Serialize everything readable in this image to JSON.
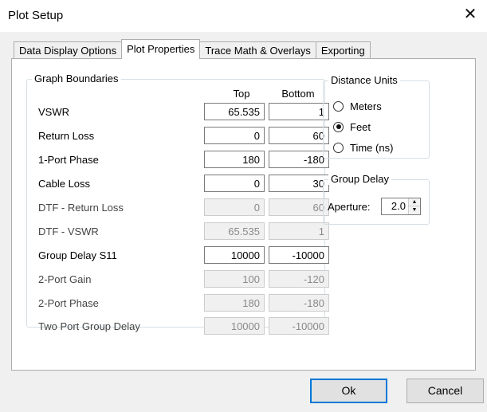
{
  "window": {
    "title": "Plot Setup",
    "close_glyph": "✕"
  },
  "tabs": [
    {
      "label": "Data Display Options",
      "active": false
    },
    {
      "label": "Plot Properties",
      "active": true
    },
    {
      "label": "Trace Math & Overlays",
      "active": false
    },
    {
      "label": "Exporting",
      "active": false
    }
  ],
  "graph_boundaries": {
    "title": "Graph Boundaries",
    "col_top": "Top",
    "col_bottom": "Bottom",
    "rows": [
      {
        "label": "VSWR",
        "top": "65.535",
        "bottom": "1",
        "enabled": true
      },
      {
        "label": "Return Loss",
        "top": "0",
        "bottom": "60",
        "enabled": true
      },
      {
        "label": "1-Port Phase",
        "top": "180",
        "bottom": "-180",
        "enabled": true
      },
      {
        "label": "Cable Loss",
        "top": "0",
        "bottom": "30",
        "enabled": true
      },
      {
        "label": "DTF - Return Loss",
        "top": "0",
        "bottom": "60",
        "enabled": false
      },
      {
        "label": "DTF - VSWR",
        "top": "65.535",
        "bottom": "1",
        "enabled": false
      },
      {
        "label": "Group Delay S11",
        "top": "10000",
        "bottom": "-10000",
        "enabled": true
      },
      {
        "label": "2-Port Gain",
        "top": "100",
        "bottom": "-120",
        "enabled": false
      },
      {
        "label": "2-Port Phase",
        "top": "180",
        "bottom": "-180",
        "enabled": false
      },
      {
        "label": "Two Port Group Delay",
        "top": "10000",
        "bottom": "-10000",
        "enabled": false
      }
    ]
  },
  "distance_units": {
    "title": "Distance Units",
    "options": [
      {
        "label": "Meters",
        "checked": false
      },
      {
        "label": "Feet",
        "checked": true
      },
      {
        "label": "Time (ns)",
        "checked": false
      }
    ]
  },
  "group_delay": {
    "title": "Group Delay",
    "aperture_label": "Aperture:",
    "aperture_value": "2.0",
    "up_glyph": "▲",
    "down_glyph": "▼"
  },
  "buttons": {
    "ok": "Ok",
    "cancel": "Cancel"
  }
}
